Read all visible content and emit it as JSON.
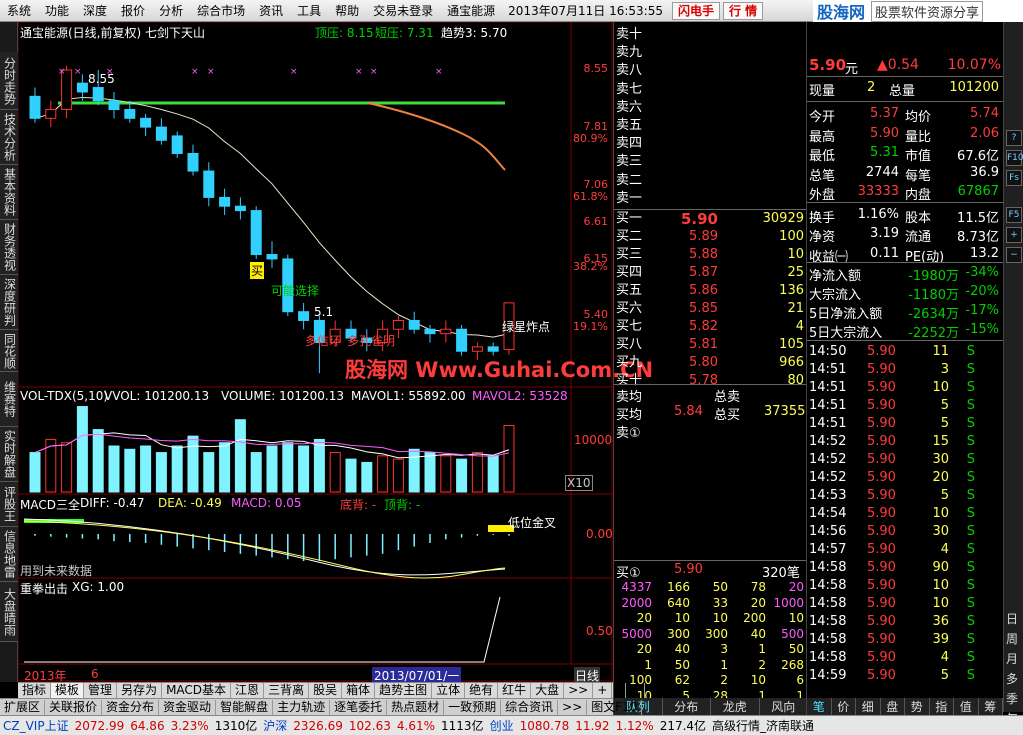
{
  "menu": {
    "items": [
      "系统",
      "功能",
      "深度",
      "报价",
      "分析",
      "综合市场",
      "资讯",
      "工具",
      "帮助",
      "交易未登录",
      "通宝能源"
    ],
    "datetime": "2013年07月11日 16:53:55",
    "btn_flash": "闪电手",
    "btn_quote": "行 情",
    "logo_main": "股海网",
    "logo_url": "www.Guhai.com.cn",
    "logo_sub": "股票软件资源分享"
  },
  "left_tabs": [
    "分时走势",
    "技术分析",
    "基本资料",
    "财务透视",
    "深度研判",
    "同花顺",
    "维赛特",
    "实时解盘",
    "评股王",
    "信息地雷",
    "大盘晴雨"
  ],
  "main_chart": {
    "title": "通宝能源(日线,前复权) 七剑下天山",
    "top_labels": {
      "dingya": "顶压: 8.15",
      "duanya": "短压: 7.31",
      "qushi": "趋势3: 5.70"
    },
    "price_axis": [
      {
        "v": "8.55",
        "c": "red"
      },
      {
        "v": "7.81",
        "c": "red"
      },
      {
        "v": "80.9%",
        "c": "red"
      },
      {
        "v": "7.06",
        "c": "red"
      },
      {
        "v": "61.8%",
        "c": "red"
      },
      {
        "v": "6.61",
        "c": "red"
      },
      {
        "v": "6.15",
        "c": "red"
      },
      {
        "v": "38.2%",
        "c": "red"
      },
      {
        "v": "5.40",
        "c": "red"
      },
      {
        "v": "19.1%",
        "c": "red"
      }
    ],
    "hi_label": "8.55",
    "lo_label": "5.1",
    "sig_buy": "买",
    "sig1": "可能选择",
    "sig2": "多信环",
    "sig3": "多孔雀明",
    "sig4": "绿星炸点"
  },
  "vol_panel": {
    "title": "VOL-TDX(5,10)",
    "vvol": "VVOL: 101200.13",
    "volume": "VOLUME: 101200.13",
    "mavol1": "MAVOL1: 55892.00",
    "mavol2": "MAVOL2: 53528",
    "axis": "10000",
    "x10": "X10"
  },
  "macd_panel": {
    "title": "MACD三全",
    "diff": "DIFF: -0.47",
    "dea": "DEA: -0.49",
    "macd": "MACD: 0.05",
    "dibei": "底背: -",
    "dingbei": "顶背: -",
    "axis": "0.00",
    "note": "低位金叉",
    "future": "用到未来数据"
  },
  "punch_panel": {
    "title": "重拳出击",
    "xg": "XG: 1.00",
    "axis": "0.50"
  },
  "date_axis": {
    "year": "2013年",
    "m": "6",
    "cursor": "2013/07/01/一",
    "period": "日线"
  },
  "chart_data": [
    {
      "type": "candlestick",
      "title": "通宝能源(日线,前复权) 七剑下天山",
      "series": [
        {
          "name": "K线",
          "values": [
            [
              8.25,
              8.35,
              7.95,
              8.0
            ],
            [
              8.0,
              8.2,
              7.9,
              8.1
            ],
            [
              8.1,
              8.6,
              8.0,
              8.55
            ],
            [
              8.4,
              8.5,
              8.2,
              8.3
            ],
            [
              8.35,
              8.55,
              8.15,
              8.2
            ],
            [
              8.2,
              8.3,
              8.0,
              8.1
            ],
            [
              8.1,
              8.2,
              7.95,
              8.0
            ],
            [
              8.0,
              8.05,
              7.8,
              7.9
            ],
            [
              7.9,
              8.0,
              7.7,
              7.75
            ],
            [
              7.8,
              7.85,
              7.55,
              7.6
            ],
            [
              7.6,
              7.7,
              7.35,
              7.4
            ],
            [
              7.4,
              7.5,
              7.0,
              7.1
            ],
            [
              7.1,
              7.2,
              6.9,
              7.0
            ],
            [
              7.0,
              7.1,
              6.85,
              6.95
            ],
            [
              6.95,
              7.0,
              6.4,
              6.45
            ],
            [
              6.45,
              6.6,
              6.3,
              6.4
            ],
            [
              6.4,
              6.45,
              5.75,
              5.8
            ],
            [
              5.8,
              5.9,
              5.6,
              5.7
            ],
            [
              5.7,
              5.75,
              5.1,
              5.45
            ],
            [
              5.45,
              5.7,
              5.4,
              5.6
            ],
            [
              5.6,
              5.7,
              5.45,
              5.5
            ],
            [
              5.5,
              5.6,
              5.35,
              5.45
            ],
            [
              5.45,
              5.7,
              5.35,
              5.6
            ],
            [
              5.6,
              5.75,
              5.5,
              5.7
            ],
            [
              5.7,
              5.8,
              5.55,
              5.6
            ],
            [
              5.6,
              5.65,
              5.45,
              5.55
            ],
            [
              5.55,
              5.7,
              5.45,
              5.6
            ],
            [
              5.6,
              5.65,
              5.3,
              5.35
            ],
            [
              5.35,
              5.45,
              5.25,
              5.4
            ],
            [
              5.4,
              5.45,
              5.3,
              5.35
            ],
            [
              5.37,
              5.9,
              5.31,
              5.9
            ]
          ]
        }
      ],
      "ylim": [
        5.0,
        8.8
      ]
    },
    {
      "type": "bar",
      "title": "VOL-TDX(5,10)",
      "values": [
        60000,
        80000,
        75000,
        130000,
        95000,
        70000,
        65000,
        70000,
        60000,
        70000,
        85000,
        60000,
        75000,
        110000,
        60000,
        70000,
        75000,
        70000,
        80000,
        60000,
        50000,
        45000,
        55000,
        50000,
        65000,
        60000,
        55000,
        50000,
        60000,
        55000,
        101200
      ]
    }
  ],
  "sell_book": [
    {
      "l": "卖十",
      "p": "",
      "v": ""
    },
    {
      "l": "卖九",
      "p": "",
      "v": ""
    },
    {
      "l": "卖八",
      "p": "",
      "v": ""
    },
    {
      "l": "卖七",
      "p": "",
      "v": ""
    },
    {
      "l": "卖六",
      "p": "",
      "v": ""
    },
    {
      "l": "卖五",
      "p": "",
      "v": ""
    },
    {
      "l": "卖四",
      "p": "",
      "v": ""
    },
    {
      "l": "卖三",
      "p": "",
      "v": ""
    },
    {
      "l": "卖二",
      "p": "",
      "v": ""
    },
    {
      "l": "卖一",
      "p": "",
      "v": ""
    }
  ],
  "buy_book": [
    {
      "l": "买一",
      "p": "5.90",
      "v": "30929"
    },
    {
      "l": "买二",
      "p": "5.89",
      "v": "100"
    },
    {
      "l": "买三",
      "p": "5.88",
      "v": "10"
    },
    {
      "l": "买四",
      "p": "5.87",
      "v": "25"
    },
    {
      "l": "买五",
      "p": "5.86",
      "v": "136"
    },
    {
      "l": "买六",
      "p": "5.85",
      "v": "21"
    },
    {
      "l": "买七",
      "p": "5.82",
      "v": "4"
    },
    {
      "l": "买八",
      "p": "5.81",
      "v": "105"
    },
    {
      "l": "买九",
      "p": "5.80",
      "v": "966"
    },
    {
      "l": "买十",
      "p": "5.78",
      "v": "80"
    }
  ],
  "book_summary": {
    "sell_avg": "卖均",
    "total_sell": "总卖",
    "buy_avg": "买均",
    "buy_avg_v": "5.84",
    "total_buy": "总买",
    "total_buy_v": "37355",
    "sell1": "卖①"
  },
  "buy1_queue": {
    "label": "买①",
    "price": "5.90",
    "count": "320笔",
    "rows": [
      [
        "4337",
        "166",
        "50",
        "78",
        "20"
      ],
      [
        "2000",
        "640",
        "33",
        "20",
        "1000"
      ],
      [
        "20",
        "10",
        "10",
        "200",
        "10"
      ],
      [
        "5000",
        "300",
        "300",
        "40",
        "500"
      ],
      [
        "20",
        "40",
        "3",
        "1",
        "50"
      ],
      [
        "1",
        "50",
        "1",
        "2",
        "268"
      ],
      [
        "100",
        "62",
        "2",
        "10",
        "6"
      ],
      [
        "10",
        "5",
        "28",
        "1",
        "1"
      ]
    ]
  },
  "book_tabs": [
    "队列",
    "分布",
    "龙虎",
    "风向"
  ],
  "watermark": "股海网 Www.Guhai.Com.CN",
  "quote": {
    "price": "5.90",
    "unit": "元",
    "change": "▲0.54",
    "pct": "10.07%",
    "xianliang_l": "现量",
    "xianliang": "2",
    "zongliang_l": "总量",
    "zongliang": "101200",
    "rows": [
      [
        "今开",
        "5.37",
        "red",
        "均价",
        "5.74",
        "red"
      ],
      [
        "最高",
        "5.90",
        "red",
        "量比",
        "2.06",
        "red"
      ],
      [
        "最低",
        "5.31",
        "grn",
        "市值",
        "67.6亿",
        "wht"
      ],
      [
        "总笔",
        "2744",
        "wht",
        "每笔",
        "36.9",
        "wht"
      ],
      [
        "外盘",
        "33333",
        "red",
        "内盘",
        "67867",
        "grn"
      ],
      [
        "换手",
        "1.16%",
        "wht",
        "股本",
        "11.5亿",
        "wht"
      ],
      [
        "净资",
        "3.19",
        "wht",
        "流通",
        "8.73亿",
        "wht"
      ],
      [
        "收益㈠",
        "0.11",
        "wht",
        "PE(动)",
        "13.2",
        "wht"
      ]
    ],
    "flows": [
      [
        "净流入额",
        "-1980万",
        "-34%"
      ],
      [
        "大宗流入",
        "-1180万",
        "-20%"
      ],
      [
        "5日净流入额",
        "-2634万",
        "-17%"
      ],
      [
        "5日大宗流入",
        "-2252万",
        "-15%"
      ]
    ]
  },
  "ticks": [
    [
      "14:50",
      "5.90",
      "11",
      "S"
    ],
    [
      "14:51",
      "5.90",
      "3",
      "S"
    ],
    [
      "14:51",
      "5.90",
      "10",
      "S"
    ],
    [
      "14:51",
      "5.90",
      "5",
      "S"
    ],
    [
      "14:51",
      "5.90",
      "5",
      "S"
    ],
    [
      "14:52",
      "5.90",
      "15",
      "S"
    ],
    [
      "14:52",
      "5.90",
      "30",
      "S"
    ],
    [
      "14:52",
      "5.90",
      "20",
      "S"
    ],
    [
      "14:53",
      "5.90",
      "5",
      "S"
    ],
    [
      "14:54",
      "5.90",
      "10",
      "S"
    ],
    [
      "14:56",
      "5.90",
      "30",
      "S"
    ],
    [
      "14:57",
      "5.90",
      "4",
      "S"
    ],
    [
      "14:58",
      "5.90",
      "90",
      "S"
    ],
    [
      "14:58",
      "5.90",
      "10",
      "S"
    ],
    [
      "14:58",
      "5.90",
      "10",
      "S"
    ],
    [
      "14:58",
      "5.90",
      "36",
      "S"
    ],
    [
      "14:58",
      "5.90",
      "39",
      "S"
    ],
    [
      "14:58",
      "5.90",
      "4",
      "S"
    ],
    [
      "14:59",
      "5.90",
      "5",
      "S"
    ]
  ],
  "tick_tabs": [
    "笔",
    "价",
    "细",
    "盘",
    "势",
    "指",
    "值",
    "筹"
  ],
  "right_icons": [
    "?",
    "F10",
    "Fs",
    "F5",
    "+",
    "−"
  ],
  "right_vtabs": [
    "日",
    "周",
    "月",
    "多",
    "季",
    "年"
  ],
  "formula_tabs": [
    "指标",
    "模板",
    "管理",
    "另存为",
    "MACD基本",
    "江恩",
    "三背离",
    "股吴",
    "箱体",
    "趋势主图",
    "立体",
    "绝有",
    "红牛",
    "大盘",
    ">>",
    "+",
    "-",
    "+"
  ],
  "exp_tabs": [
    "扩展区",
    "关联报价",
    "资金分布",
    "资金驱动",
    "智能解盘",
    "主力轨迹",
    "逐笔委托",
    "热点题材",
    "一致预期",
    "综合资讯",
    ">>",
    "图文F10"
  ],
  "status": [
    [
      "CZ_VIP上证",
      "wht"
    ],
    [
      "2072.99",
      "red"
    ],
    [
      "64.86",
      "red"
    ],
    [
      "3.23%",
      "red"
    ],
    [
      "1310亿",
      "blk"
    ],
    [
      "沪深",
      "wht"
    ],
    [
      "2326.69",
      "red"
    ],
    [
      "102.63",
      "red"
    ],
    [
      "4.61%",
      "red"
    ],
    [
      "1113亿",
      "blk"
    ],
    [
      "创业",
      "wht"
    ],
    [
      "1080.78",
      "red"
    ],
    [
      "11.92",
      "red"
    ],
    [
      "1.12%",
      "red"
    ],
    [
      "217.4亿",
      "blk"
    ],
    [
      "高级行情_济南联通",
      "blk"
    ]
  ]
}
